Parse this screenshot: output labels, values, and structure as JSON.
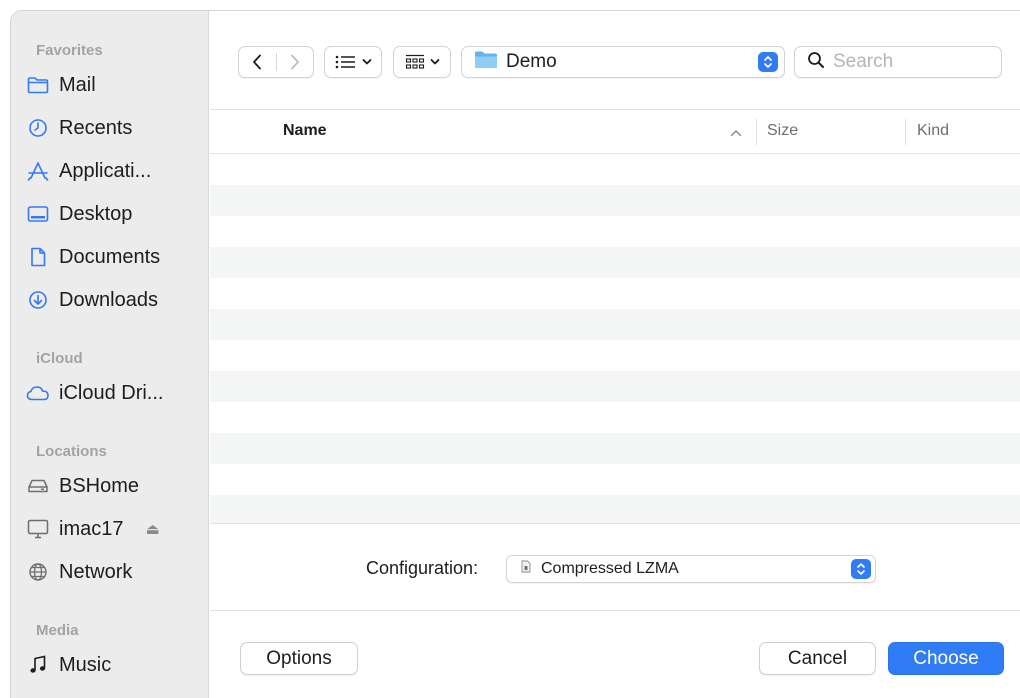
{
  "sidebar": {
    "sections": [
      {
        "title": "Favorites",
        "items": [
          {
            "label": "Mail",
            "icon": "folder-icon"
          },
          {
            "label": "Recents",
            "icon": "clock-icon"
          },
          {
            "label": "Applicati...",
            "icon": "applications-icon"
          },
          {
            "label": "Desktop",
            "icon": "desktop-icon"
          },
          {
            "label": "Documents",
            "icon": "document-icon"
          },
          {
            "label": "Downloads",
            "icon": "download-icon"
          }
        ]
      },
      {
        "title": "iCloud",
        "items": [
          {
            "label": "iCloud Dri...",
            "icon": "cloud-icon"
          }
        ]
      },
      {
        "title": "Locations",
        "items": [
          {
            "label": "BSHome",
            "icon": "drive-icon"
          },
          {
            "label": "imac17",
            "icon": "computer-icon",
            "eject": "⏏"
          },
          {
            "label": "Network",
            "icon": "globe-icon"
          }
        ]
      },
      {
        "title": "Media",
        "items": [
          {
            "label": "Music",
            "icon": "music-icon"
          }
        ]
      }
    ]
  },
  "toolbar": {
    "path_label": "Demo",
    "search_placeholder": "Search"
  },
  "list": {
    "columns": {
      "name": "Name",
      "size": "Size",
      "kind": "Kind"
    },
    "row_count": 12
  },
  "config": {
    "label": "Configuration:",
    "value": "Compressed LZMA"
  },
  "buttons": {
    "options": "Options",
    "cancel": "Cancel",
    "choose": "Choose"
  },
  "colors": {
    "accent": "#2f7cf6",
    "sidebar_bg": "#ececec",
    "icon_blue": "#3478f6"
  }
}
